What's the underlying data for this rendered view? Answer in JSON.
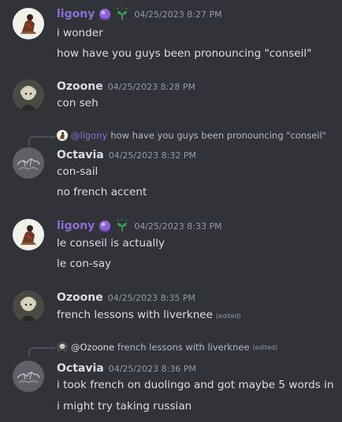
{
  "colors": {
    "background": "#313338",
    "ligony_name": "#8b6fd6",
    "ozoone_name": "#dbdee1",
    "octavia_name": "#dbdee1",
    "timestamp": "#949ba4",
    "text": "#dbdee1"
  },
  "messages": [
    {
      "author": "ligony",
      "badges": [
        "crystal-ball-icon",
        "sprout-icon"
      ],
      "timestamp": "04/25/2023 8:27 PM",
      "lines": [
        "i wonder",
        "how have you guys been pronouncing \"conseil\""
      ]
    },
    {
      "author": "Ozoone",
      "timestamp": "04/25/2023 8:28 PM",
      "lines": [
        "con seh"
      ]
    },
    {
      "reply": {
        "author": "@ligony",
        "text": "how have you guys been pronouncing \"conseil\""
      },
      "author": "Octavia",
      "timestamp": "04/25/2023 8:32 PM",
      "lines": [
        "con-sail",
        "no french accent"
      ]
    },
    {
      "author": "ligony",
      "badges": [
        "crystal-ball-icon",
        "sprout-icon"
      ],
      "timestamp": "04/25/2023 8:33 PM",
      "lines": [
        "le conseil is actually",
        "le con-say"
      ]
    },
    {
      "author": "Ozoone",
      "timestamp": "04/25/2023 8:35 PM",
      "lines": [
        "french lessons with liverknee"
      ],
      "edited": "(edited)"
    },
    {
      "reply": {
        "author": "@Ozoone",
        "text": "french lessons with liverknee",
        "edited": "(edited)"
      },
      "author": "Octavia",
      "timestamp": "04/25/2023 8:36 PM",
      "lines": [
        "i took french on duolingo and got maybe 5 words in",
        "i might try taking russian"
      ]
    }
  ]
}
